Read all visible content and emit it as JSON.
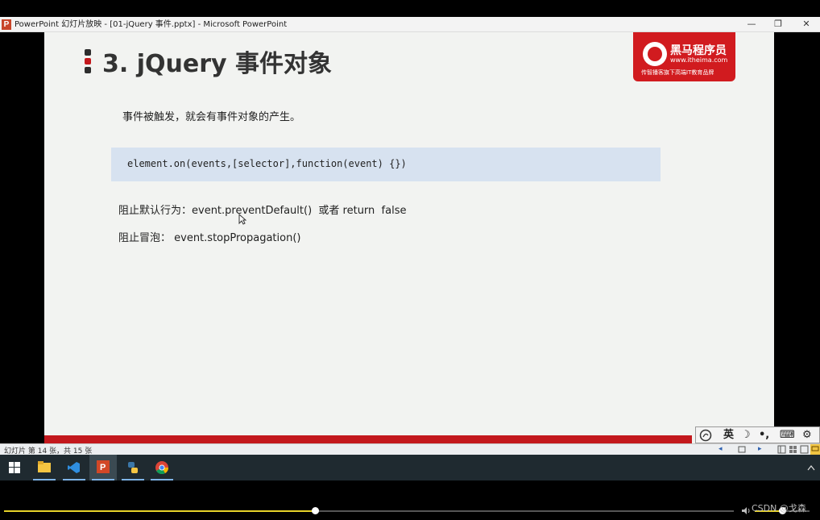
{
  "window": {
    "title": "PowerPoint 幻灯片放映 - [01-jQuery 事件.pptx] - Microsoft PowerPoint",
    "app_icon": "P",
    "min_icon": "—",
    "restore_icon": "❐",
    "close_icon": "✕"
  },
  "slide": {
    "title": "3. jQuery 事件对象",
    "logo": {
      "name": "黑马程序员",
      "url": "www.itheima.com",
      "slogan": "传智播客旗下高端IT教育品牌"
    },
    "intro": "事件被触发，就会有事件对象的产生。",
    "code": "element.on(events,[selector],function(event) {})",
    "line1": "阻止默认行为：event.preventDefault()  或者 return  false",
    "line2": "阻止冒泡： event.stopPropagation()"
  },
  "ime_toolbar": {
    "lang": "英",
    "moon": "☽",
    "punct": "•,",
    "keyboard": "⌨",
    "settings": "⚙"
  },
  "statusbar": {
    "text": "幻灯片 第 14 张，共 15 张",
    "prev_icon": "◂",
    "next_icon": "▸"
  },
  "player": {
    "progress": 0.426,
    "volume": 0.5,
    "watermark": "CSDN @戈森"
  },
  "colors": {
    "accent_red": "#c3181d",
    "code_bg": "#d7e2f0",
    "progress_yellow": "#e6d22a"
  }
}
